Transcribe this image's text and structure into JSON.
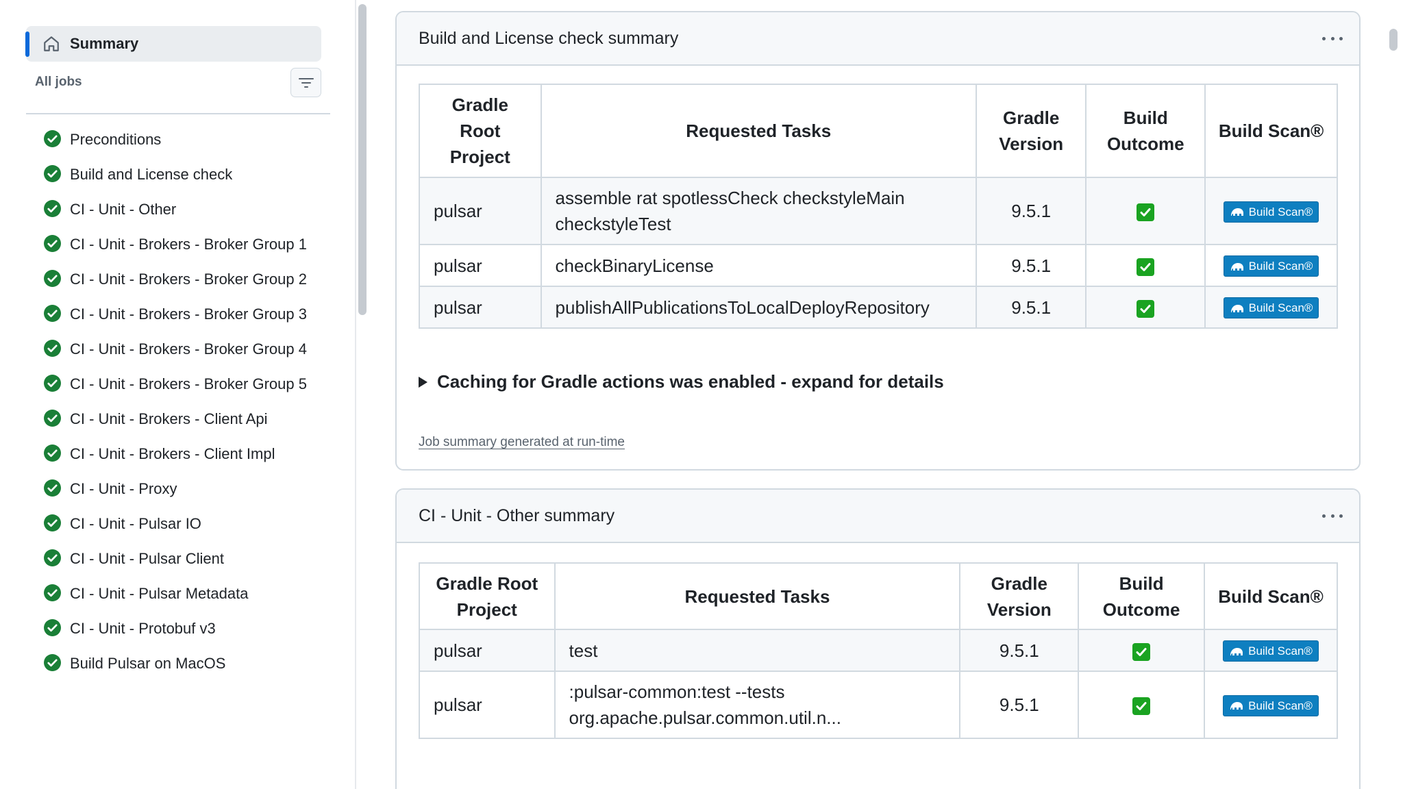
{
  "sidebar": {
    "summary_label": "Summary",
    "all_jobs_label": "All jobs",
    "jobs": [
      {
        "label": "Preconditions",
        "status": "success"
      },
      {
        "label": "Build and License check",
        "status": "success"
      },
      {
        "label": "CI - Unit - Other",
        "status": "success"
      },
      {
        "label": "CI - Unit - Brokers - Broker Group 1",
        "status": "success"
      },
      {
        "label": "CI - Unit - Brokers - Broker Group 2",
        "status": "success"
      },
      {
        "label": "CI - Unit - Brokers - Broker Group 3",
        "status": "success"
      },
      {
        "label": "CI - Unit - Brokers - Broker Group 4",
        "status": "success"
      },
      {
        "label": "CI - Unit - Brokers - Broker Group 5",
        "status": "success"
      },
      {
        "label": "CI - Unit - Brokers - Client Api",
        "status": "success"
      },
      {
        "label": "CI - Unit - Brokers - Client Impl",
        "status": "success"
      },
      {
        "label": "CI - Unit - Proxy",
        "status": "success"
      },
      {
        "label": "CI - Unit - Pulsar IO",
        "status": "success"
      },
      {
        "label": "CI - Unit - Pulsar Client",
        "status": "success"
      },
      {
        "label": "CI - Unit - Pulsar Metadata",
        "status": "success"
      },
      {
        "label": "CI - Unit - Protobuf v3",
        "status": "success"
      },
      {
        "label": "Build Pulsar on MacOS",
        "status": "success"
      }
    ]
  },
  "cards": [
    {
      "title": "Build and License check summary",
      "headers": [
        "Gradle Root Project",
        "Requested Tasks",
        "Gradle Version",
        "Build Outcome",
        "Build Scan®"
      ],
      "rows": [
        {
          "project": "pulsar",
          "tasks": "assemble rat spotlessCheck checkstyleMain checkstyleTest",
          "version": "9.5.1",
          "outcome": "✅",
          "scan": "Build Scan®"
        },
        {
          "project": "pulsar",
          "tasks": "checkBinaryLicense",
          "version": "9.5.1",
          "outcome": "✅",
          "scan": "Build Scan®"
        },
        {
          "project": "pulsar",
          "tasks": "publishAllPublicationsToLocalDeployRepository",
          "version": "9.5.1",
          "outcome": "✅",
          "scan": "Build Scan®"
        }
      ],
      "details_label": "Caching for Gradle actions was enabled - expand for details",
      "generated_link": "Job summary generated at run-time"
    },
    {
      "title": "CI - Unit - Other summary",
      "headers": [
        "Gradle Root Project",
        "Requested Tasks",
        "Gradle Version",
        "Build Outcome",
        "Build Scan®"
      ],
      "rows": [
        {
          "project": "pulsar",
          "tasks": "test",
          "version": "9.5.1",
          "outcome": "✅",
          "scan": "Build Scan®"
        },
        {
          "project": "pulsar",
          "tasks": ":pulsar-common:test --tests org.apache.pulsar.common.util.n...",
          "version": "9.5.1",
          "outcome": "✅",
          "scan": "Build Scan®"
        }
      ]
    }
  ],
  "colors": {
    "accent": "#0969da",
    "success": "#1a7f37",
    "scan_button": "#0e7fc0",
    "outcome_box": "#1aa321"
  },
  "icons": {
    "summary": "home-icon",
    "filter": "filter-icon",
    "job_status": "check-circle-icon",
    "menu": "kebab-horizontal-icon",
    "scan": "elephant-icon"
  }
}
